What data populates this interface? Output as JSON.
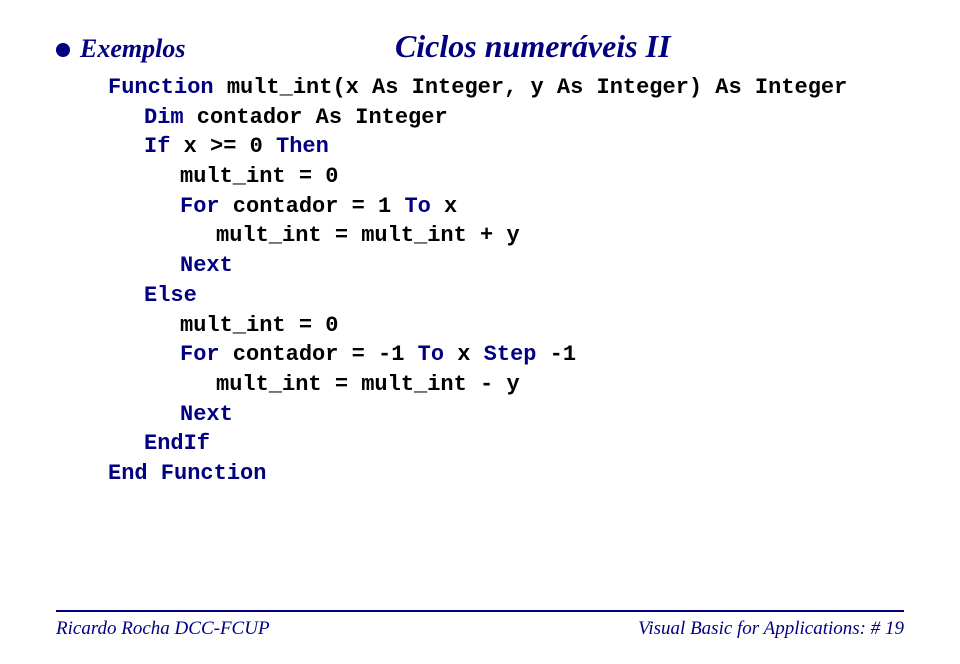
{
  "header": {
    "section_label": "Exemplos",
    "title": "Ciclos numeráveis II"
  },
  "code": {
    "line1_pre": "Function",
    "line1_rest": " mult_int(x As Integer, y As Integer) As Integer",
    "line2_pre": "Dim",
    "line2_rest": " contador As Integer",
    "line3_pre": "If",
    "line3_mid": " x >= 0 ",
    "line3_post": "Then",
    "line4": "mult_int = 0",
    "line5_pre": "For",
    "line5_mid": " contador = 1 ",
    "line5_post": "To",
    "line5_end": " x",
    "line6": "mult_int = mult_int + y",
    "line7": "Next",
    "line8": "Else",
    "line9": "mult_int = 0",
    "line10_pre": "For",
    "line10_mid": " contador = -1 ",
    "line10_post1": "To",
    "line10_mid2": " x ",
    "line10_post2": "Step",
    "line10_end": " -1",
    "line11": "mult_int = mult_int - y",
    "line12": "Next",
    "line13": "EndIf",
    "line14": "End Function"
  },
  "footer": {
    "left": "Ricardo Rocha DCC-FCUP",
    "right": "Visual Basic for Applications: # 19"
  }
}
